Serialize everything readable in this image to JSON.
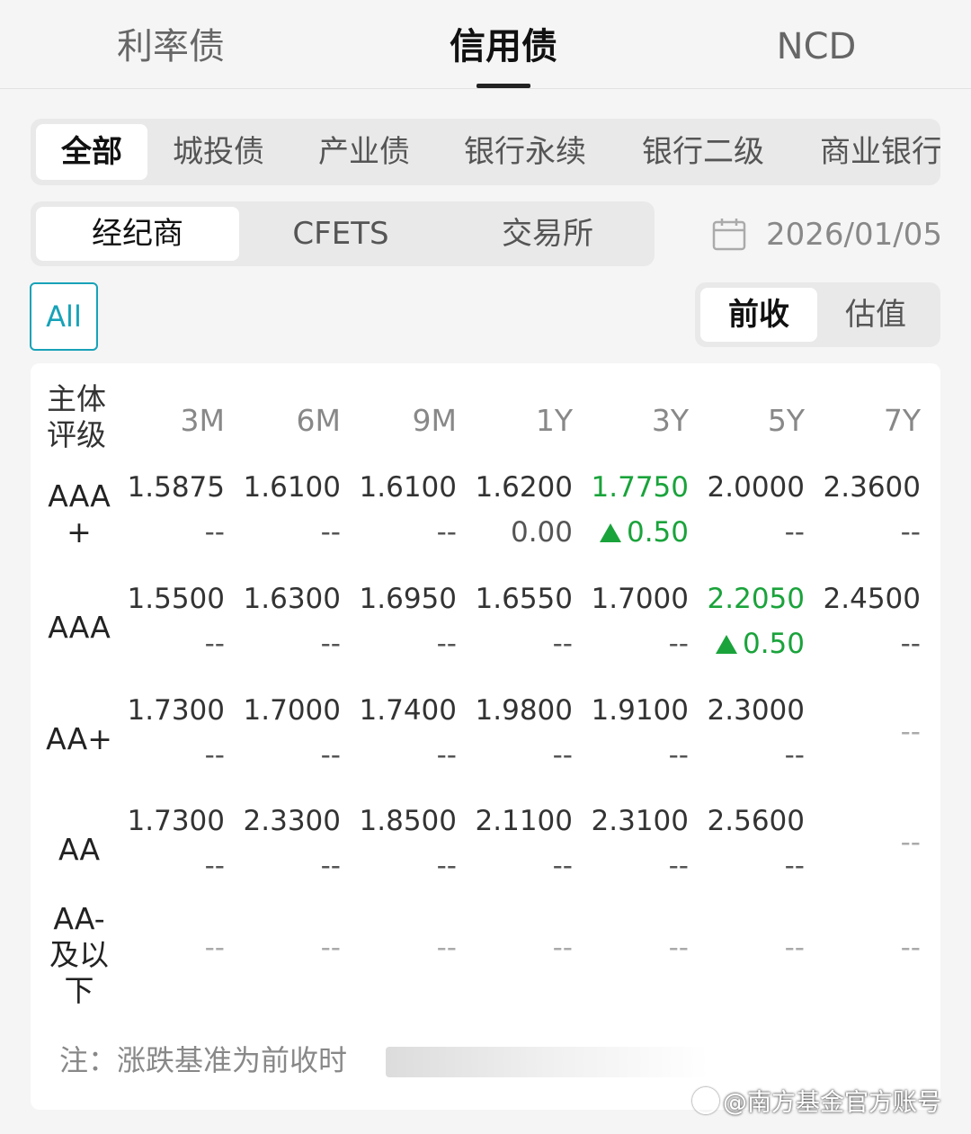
{
  "top_tabs": [
    "利率债",
    "信用债",
    "NCD"
  ],
  "categories": [
    "全部",
    "城投债",
    "产业债",
    "银行永续",
    "银行二级",
    "商业银行"
  ],
  "sources": [
    "经纪商",
    "CFETS",
    "交易所"
  ],
  "date": "2026/01/05",
  "all_label": "All",
  "modes": [
    "前收",
    "估值"
  ],
  "table": {
    "rating_header": [
      "主体",
      "评级"
    ],
    "columns": [
      "3M",
      "6M",
      "9M",
      "1Y",
      "3Y",
      "5Y",
      "7Y"
    ],
    "rows": [
      {
        "label": [
          "AAA",
          "+"
        ],
        "values": [
          "1.5875",
          "1.6100",
          "1.6100",
          "1.6200",
          "1.7750",
          "2.0000",
          "2.3600"
        ],
        "changes": [
          "--",
          "--",
          "--",
          "0.00",
          "0.50",
          "--",
          "--"
        ]
      },
      {
        "label": [
          "AAA"
        ],
        "values": [
          "1.5500",
          "1.6300",
          "1.6950",
          "1.6550",
          "1.7000",
          "2.2050",
          "2.4500"
        ],
        "changes": [
          "--",
          "--",
          "--",
          "--",
          "--",
          "0.50",
          "--"
        ]
      },
      {
        "label": [
          "AA+"
        ],
        "values": [
          "1.7300",
          "1.7000",
          "1.7400",
          "1.9800",
          "1.9100",
          "2.3000",
          ""
        ],
        "changes": [
          "--",
          "--",
          "--",
          "--",
          "--",
          "--",
          "--"
        ]
      },
      {
        "label": [
          "AA"
        ],
        "values": [
          "1.7300",
          "2.3300",
          "1.8500",
          "2.1100",
          "2.3100",
          "2.5600",
          ""
        ],
        "changes": [
          "--",
          "--",
          "--",
          "--",
          "--",
          "--",
          "--"
        ]
      },
      {
        "label": [
          "AA-",
          "及以",
          "下"
        ],
        "values": [
          "",
          "",
          "",
          "",
          "",
          "",
          ""
        ],
        "changes": [
          "--",
          "--",
          "--",
          "--",
          "--",
          "--",
          "--"
        ]
      }
    ]
  },
  "note": "注：涨跌基准为前收时",
  "watermark": "@南方基金官方账号",
  "colors": {
    "accent": "#17a2b8",
    "up": "#1aa33b"
  }
}
